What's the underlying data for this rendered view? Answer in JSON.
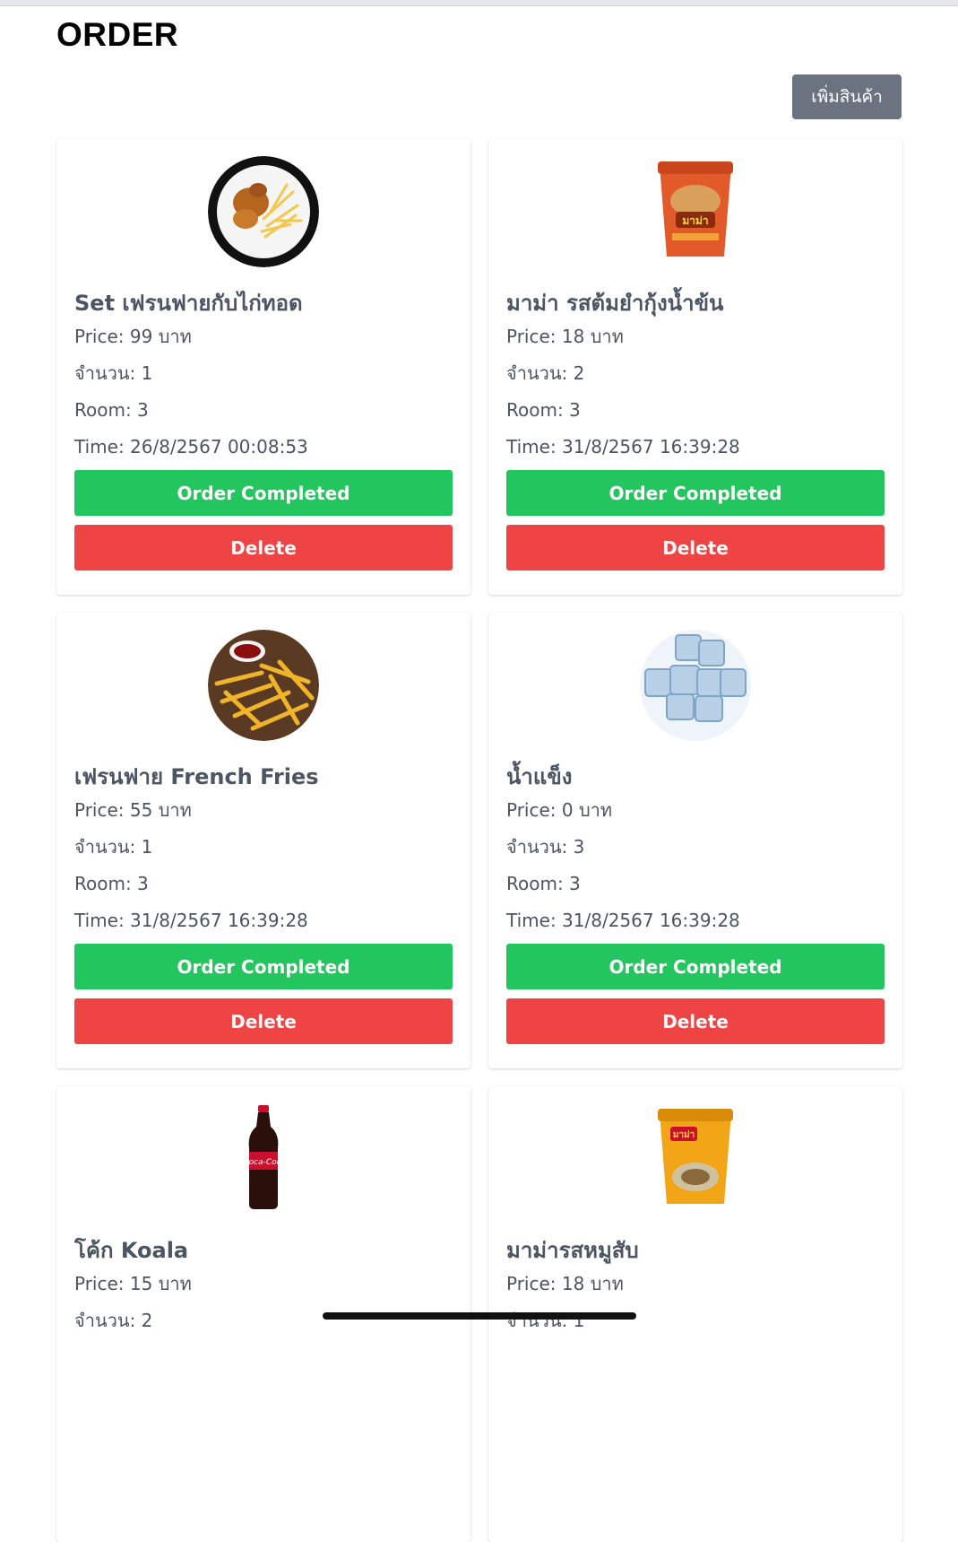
{
  "page": {
    "title": "ORDER",
    "add_button": "เพิ่มสินค้า"
  },
  "labels": {
    "price": "Price:",
    "quantity": "จำนวน:",
    "room": "Room:",
    "time": "Time:",
    "currency": "บาท"
  },
  "actions": {
    "complete": "Order Completed",
    "delete": "Delete"
  },
  "orders": [
    {
      "name": "Set เฟรนฟายกับไก่ทอด",
      "price": "Price: 99 บาท",
      "quantity": "จำนวน: 1",
      "room": "Room: 3",
      "time": "Time: 26/8/2567 00:08:53",
      "image_icon": "chicken-fries-plate-icon"
    },
    {
      "name": "มาม่า รสต้มยำกุ้งน้ำข้น",
      "price": "Price: 18 บาท",
      "quantity": "จำนวน: 2",
      "room": "Room: 3",
      "time": "Time: 31/8/2567 16:39:28",
      "image_icon": "tomyum-noodle-cup-icon"
    },
    {
      "name": "เฟรนฟาย French Fries",
      "price": "Price: 55 บาท",
      "quantity": "จำนวน: 1",
      "room": "Room: 3",
      "time": "Time: 31/8/2567 16:39:28",
      "image_icon": "french-fries-icon"
    },
    {
      "name": "น้ำแข็ง",
      "price": "Price: 0 บาท",
      "quantity": "จำนวน: 3",
      "room": "Room: 3",
      "time": "Time: 31/8/2567 16:39:28",
      "image_icon": "ice-cubes-icon"
    },
    {
      "name": "โค้ก Koala",
      "price": "Price: 15 บาท",
      "quantity": "จำนวน: 2",
      "room": "",
      "time": "",
      "image_icon": "cola-bottle-icon"
    },
    {
      "name": "มาม่ารสหมูสับ",
      "price": "Price: 18 บาท",
      "quantity": "จำนวน: 1",
      "room": "",
      "time": "",
      "image_icon": "minced-pork-noodle-cup-icon"
    }
  ],
  "colors": {
    "complete": "#22c55e",
    "delete": "#ef4444",
    "add_button": "#6b7280"
  }
}
